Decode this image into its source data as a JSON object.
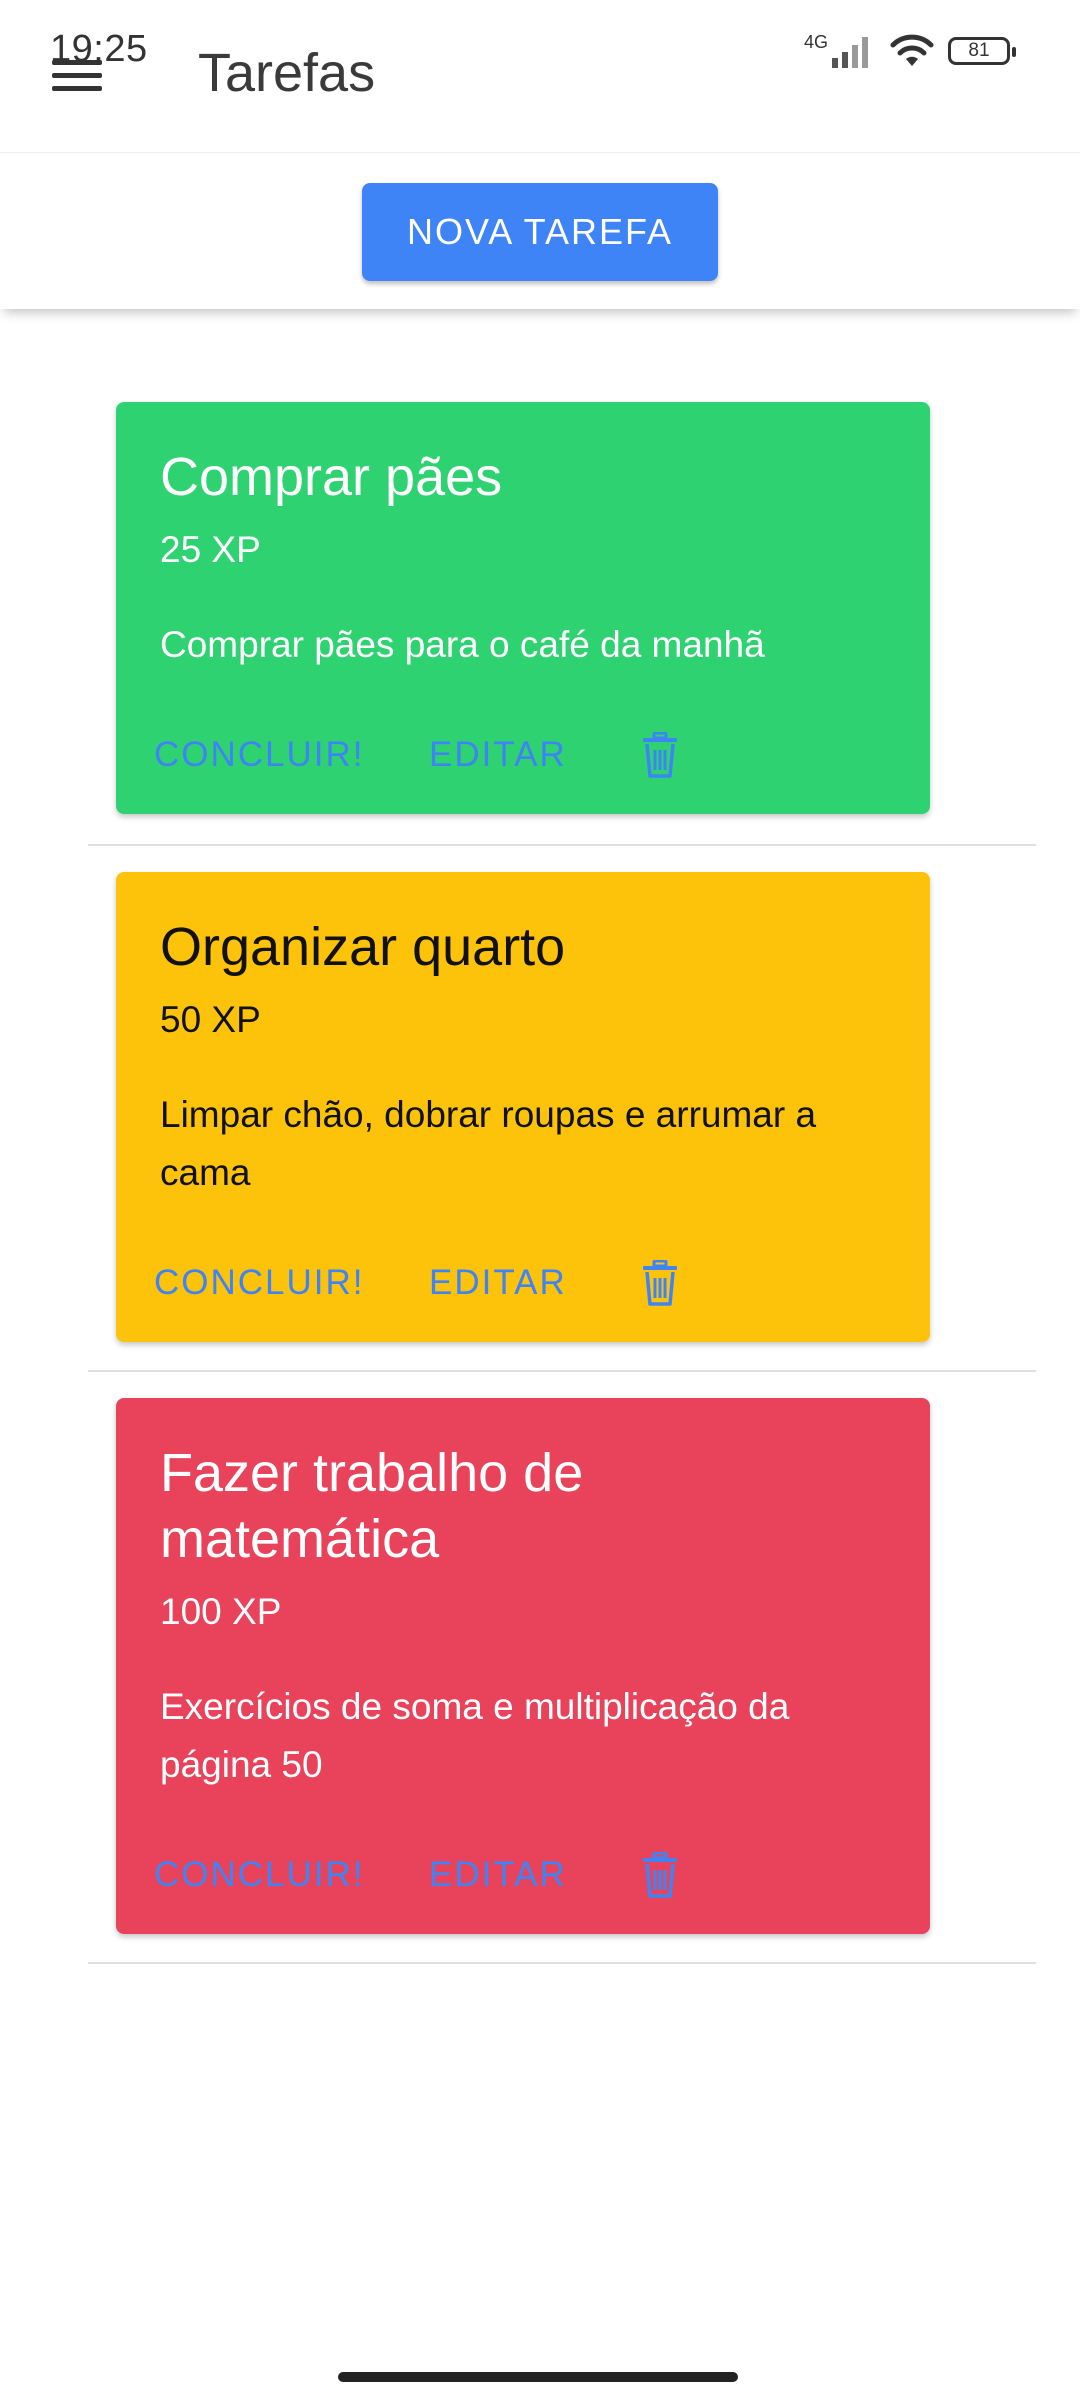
{
  "status_bar": {
    "time": "19:25",
    "network": "4G",
    "battery": "81"
  },
  "app_bar": {
    "title": "Tarefas",
    "menu_icon": "hamburger-menu-icon"
  },
  "toolbar": {
    "new_task_label": "NOVA TAREFA"
  },
  "colors": {
    "accent": "#3f84f6",
    "card_easy": "#2fd271",
    "card_medium": "#fdc20a",
    "card_hard": "#e8435b"
  },
  "tasks": [
    {
      "title": "Comprar pães",
      "xp": "25 XP",
      "description": "Comprar pães para o café da manhã",
      "complete_label": "CONCLUIR!",
      "edit_label": "EDITAR",
      "delete_icon": "trash-icon"
    },
    {
      "title": "Organizar quarto",
      "xp": "50 XP",
      "description": "Limpar chão, dobrar roupas e arrumar a cama",
      "complete_label": "CONCLUIR!",
      "edit_label": "EDITAR",
      "delete_icon": "trash-icon"
    },
    {
      "title": "Fazer trabalho de matemática",
      "xp": "100 XP",
      "description": "Exercícios de soma e multiplicação da página 50",
      "complete_label": "CONCLUIR!",
      "edit_label": "EDITAR",
      "delete_icon": "trash-icon"
    }
  ]
}
